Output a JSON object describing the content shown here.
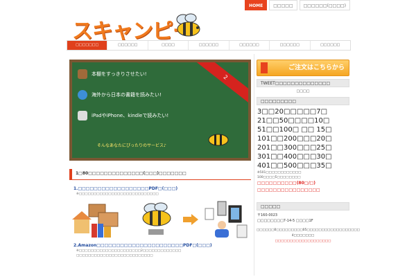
{
  "header": {
    "logo_text": "スキャンピー",
    "top_nav": [
      {
        "label": "HOME",
        "active": true
      },
      {
        "label": "□□□□□",
        "active": false
      },
      {
        "label": "□□□□□□(□□□□)",
        "active": false
      }
    ]
  },
  "main_nav": [
    {
      "label": "□□□□□□□",
      "active": true
    },
    {
      "label": "□□□□□□",
      "active": false
    },
    {
      "label": "□□□□",
      "active": false
    },
    {
      "label": "□□□□□□",
      "active": false
    },
    {
      "label": "□□□□□□",
      "active": false
    },
    {
      "label": "□□□□□□",
      "active": false
    },
    {
      "label": "□□□□□□",
      "active": false
    }
  ],
  "hero": {
    "line1": "本棚をすっきりさせたい!",
    "line2": "海外から日本の書籍を読みたい!",
    "line3": "iPadやiPhone、kindleで読みたい!",
    "tagline": "そんなあなたにぴったりのサービス♪",
    "ribbon": "2"
  },
  "main": {
    "section_title": "1□80□□□□□□□□□□□□□□(□□□)□□□□□□□",
    "item1_title": "1.□□□□□□□□□□□□□□□□□□PDF□(□□□)",
    "item1_note": "※□□□□□□□□□□□□□□□□□□□□□□□□□□□",
    "item2_title": "2.Amazon□□□□□□□□□□□□□□□□□□□□□□PDF□(□□□)",
    "item2_note1": "※□□□□□□□□□□□□□□□□□□□□□2□□□□□□□□□□□□□",
    "item2_note2": "□□□□□□□□□□□□□□□□□□□□□□□□□□"
  },
  "sidebar": {
    "order_button": "ご注文はこちらから",
    "tweet_head": "TWEET□□□□□□□□□□□□□□",
    "tweet_link": "□□□□",
    "price_head": "□□□□□□□□□",
    "prices": [
      "3□□20□□□□□7□",
      "21□□50□□□□10□",
      "51□□100□ □□ 15□",
      "101□□200□□□20□",
      "201□□300□□□25□",
      "301□□400□□□30□",
      "401□□500□□□35□"
    ],
    "price_note1": "※501□□□□□□□□□□□□",
    "price_note2": "100□□□□5□□□□□□□□",
    "price_red1": "□□□□□□□□□□(80□/□)",
    "price_red2": "□□□□□□□□□□□□□□□□",
    "addr_head": "□□□□□",
    "addr1": "〒160-0023",
    "addr2": "□□□□□□□□7-14-5 □□□□1F",
    "center_note1": "□□□□□□0□□□□□□□□□05□□□□□□□□□□□□□□□□□□",
    "center_note2": "4□□□□□□□",
    "center_red": "□□□□□□□□□□□□□□□□□□□"
  },
  "colors": {
    "accent": "#e0401c",
    "board": "#2f6b3a",
    "order": "#f5a623",
    "link_blue": "#224c9e"
  }
}
